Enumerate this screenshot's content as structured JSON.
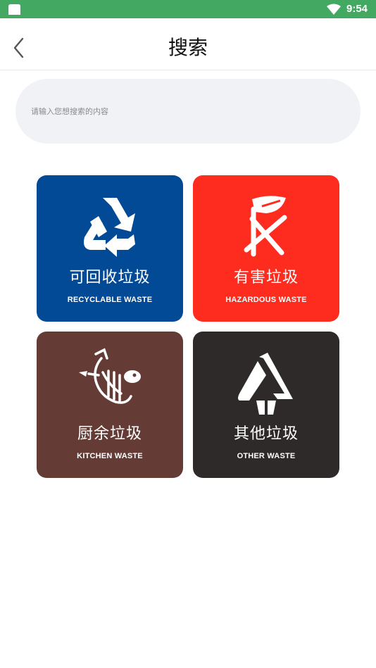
{
  "status_bar": {
    "time": "9:54",
    "icons": [
      "sim-card-icon",
      "wifi-icon"
    ]
  },
  "header": {
    "title": "搜索",
    "back_icon": "chevron-left-icon"
  },
  "search": {
    "placeholder": "请输入您想搜索的内容",
    "value": ""
  },
  "categories": [
    {
      "name_cn": "可回收垃圾",
      "name_en": "RECYCLABLE WASTE",
      "color": "#034a96",
      "icon": "recycle-icon"
    },
    {
      "name_cn": "有害垃圾",
      "name_en": "HAZARDOUS WASTE",
      "color": "#fd2c1f",
      "icon": "hazardous-icon"
    },
    {
      "name_cn": "厨余垃圾",
      "name_en": "KITCHEN WASTE",
      "color": "#653c35",
      "icon": "kitchen-waste-icon"
    },
    {
      "name_cn": "其他垃圾",
      "name_en": "OTHER WASTE",
      "color": "#2e2a29",
      "icon": "other-waste-icon"
    }
  ],
  "colors": {
    "status_bar": "#43a862",
    "search_bg": "#f1f2f6"
  }
}
